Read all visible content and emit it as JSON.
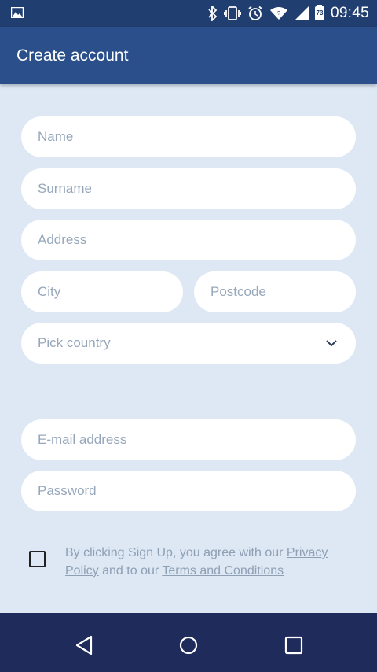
{
  "status_bar": {
    "time": "09:45",
    "battery_level": "73",
    "icons": [
      "image-icon",
      "bluetooth-icon",
      "vibrate-icon",
      "alarm-icon",
      "wifi-icon",
      "signal-icon",
      "battery-icon"
    ]
  },
  "app_bar": {
    "title": "Create account"
  },
  "form": {
    "name_placeholder": "Name",
    "surname_placeholder": "Surname",
    "address_placeholder": "Address",
    "city_placeholder": "City",
    "postcode_placeholder": "Postcode",
    "country_placeholder": "Pick country",
    "email_placeholder": "E-mail address",
    "password_placeholder": "Password"
  },
  "terms": {
    "checked": false,
    "text_before": "By clicking Sign Up, you agree with our ",
    "privacy_link": "Privacy Policy",
    "text_middle": " and to our ",
    "terms_link": "Terms and Conditions"
  },
  "nav_bar": {
    "icons": [
      "back-icon",
      "home-icon",
      "recents-icon"
    ]
  },
  "colors": {
    "status_bar": "#213e70",
    "app_bar": "#2b4f8b",
    "background": "#dde8f4",
    "field": "#ffffff",
    "placeholder": "#97a7bb",
    "nav_bar": "#1f2c5b"
  }
}
